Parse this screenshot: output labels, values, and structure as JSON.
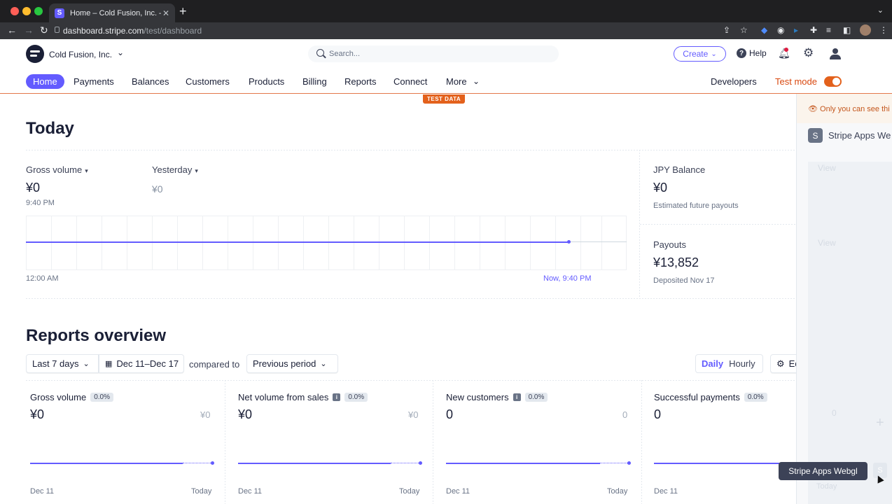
{
  "browser": {
    "tab_title": "Home – Cold Fusion, Inc. – Stri",
    "tab_favicon": "S",
    "url_host": "dashboard.stripe.com",
    "url_path": "/test/dashboard"
  },
  "header": {
    "account_name": "Cold Fusion, Inc.",
    "search_placeholder": "Search...",
    "create_label": "Create",
    "help_label": "Help"
  },
  "nav": {
    "items": [
      "Home",
      "Payments",
      "Balances",
      "Customers",
      "Products",
      "Billing",
      "Reports",
      "Connect",
      "More"
    ],
    "developers": "Developers",
    "test_mode": "Test mode",
    "test_badge": "TEST DATA"
  },
  "today": {
    "title": "Today",
    "gross_label": "Gross volume",
    "gross_value": "¥0",
    "gross_time": "9:40 PM",
    "yesterday_label": "Yesterday",
    "yesterday_value": "¥0",
    "axis_start": "12:00 AM",
    "axis_now": "Now, 9:40 PM",
    "jpy_label": "JPY Balance",
    "jpy_value": "¥0",
    "jpy_sub": "Estimated future payouts",
    "payouts_label": "Payouts",
    "payouts_value": "¥13,852",
    "payouts_sub": "Deposited Nov 17"
  },
  "reports": {
    "title": "Reports overview",
    "range": "Last 7 days",
    "dates": "Dec 11–Dec 17",
    "compared_to": "compared to",
    "period": "Previous period",
    "daily": "Daily",
    "hourly": "Hourly",
    "edit_charts": "Edit charts",
    "cards": [
      {
        "title": "Gross volume",
        "pct": "0.0%",
        "value": "¥0",
        "compare": "¥0",
        "start": "Dec 11",
        "end": "Today"
      },
      {
        "title": "Net volume from sales",
        "pct": "0.0%",
        "value": "¥0",
        "compare": "¥0",
        "start": "Dec 11",
        "end": "Today"
      },
      {
        "title": "New customers",
        "pct": "0.0%",
        "value": "0",
        "compare": "0",
        "start": "Dec 11",
        "end": "Today"
      },
      {
        "title": "Successful payments",
        "pct": "0.0%",
        "value": "0",
        "compare": "0",
        "start": "Dec 11",
        "end": "Today"
      }
    ]
  },
  "right_panel": {
    "banner": "Only you can see thi",
    "app_icon": "S",
    "app_name": "Stripe Apps We",
    "view_1": "View",
    "view_2": "View",
    "ghost_zero": "0",
    "ghost_today": "Today",
    "tooltip": "Stripe Apps Webgl",
    "corner_icon": "S"
  },
  "colors": {
    "accent": "#635bff",
    "test_orange": "#e3611c",
    "text": "#1a1f36",
    "chrome": "#1f1f21"
  }
}
